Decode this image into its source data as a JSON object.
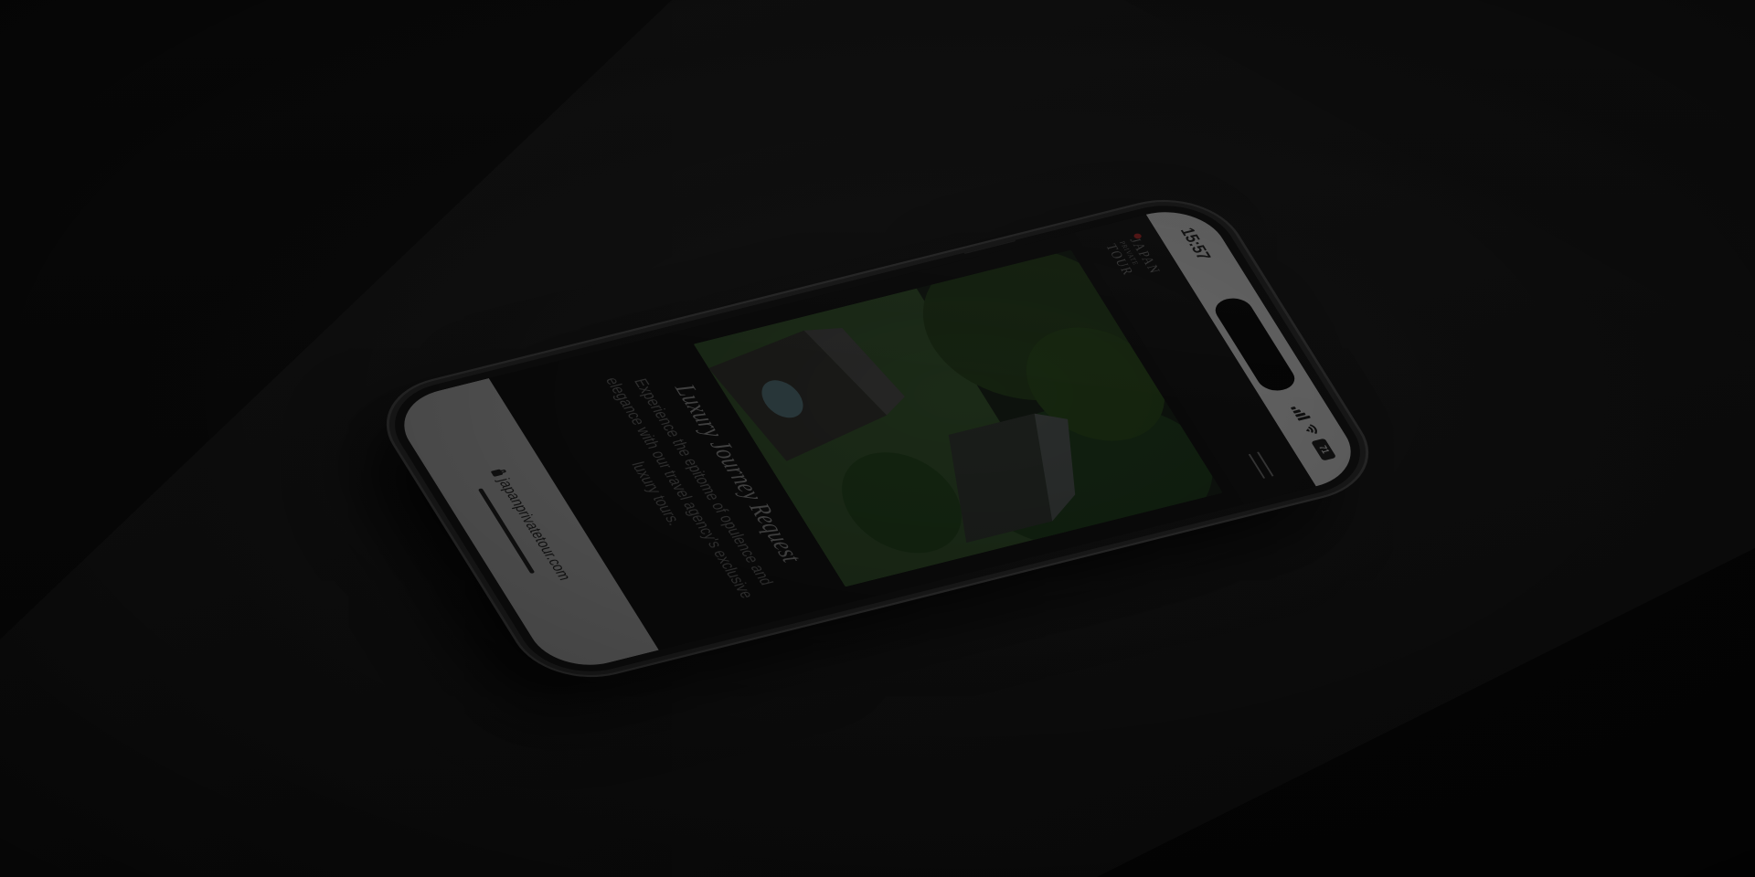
{
  "status_bar": {
    "time": "15:57",
    "battery": "71"
  },
  "header": {
    "logo_line1": "JAPAN",
    "logo_line2": "PRIVATE",
    "logo_line3": "TOUR"
  },
  "hero": {
    "image_label": "garden-pavilion-photo"
  },
  "content": {
    "title": "Luxury Journey Request",
    "description": "Experience the epitome of opulence and elegance with our travel agency's exclusive luxury tours."
  },
  "browser": {
    "url": "japanprivatetour.com"
  },
  "colors": {
    "background": "#080808",
    "status_bar": "#6a6a6a",
    "logo_dot": "#5a1515",
    "text_muted": "#474747"
  },
  "icons": {
    "menu": "hamburger-menu-icon",
    "lock": "lock-icon",
    "wifi": "wifi-icon",
    "signal": "cellular-signal-icon",
    "battery": "battery-icon"
  }
}
